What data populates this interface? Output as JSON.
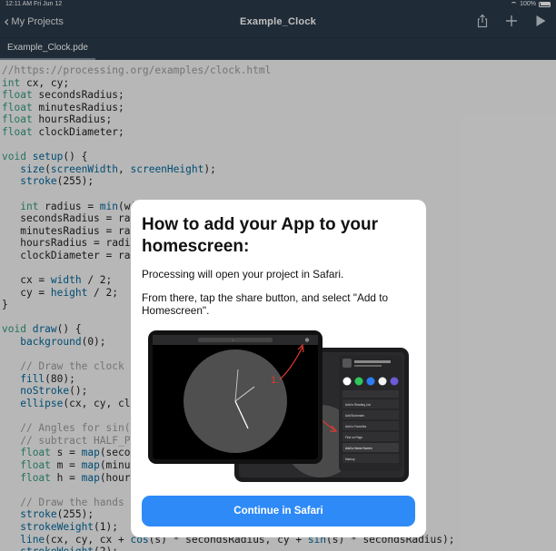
{
  "status_bar": {
    "time": "12:11 AM   Fri Jun 12",
    "battery": "100%",
    "battery_level": 1.0
  },
  "nav": {
    "back_label": "My Projects",
    "title": "Example_Clock",
    "icons": [
      "share-icon",
      "plus-icon",
      "play-icon"
    ]
  },
  "tab": {
    "label": "Example_Clock.pde"
  },
  "code_lines": [
    [
      [
        "cm",
        "//https://processing.org/examples/clock.html"
      ]
    ],
    [
      [
        "kw",
        "int"
      ],
      [
        "",
        " cx, cy;"
      ]
    ],
    [
      [
        "kw",
        "float"
      ],
      [
        "",
        " secondsRadius;"
      ]
    ],
    [
      [
        "kw",
        "float"
      ],
      [
        "",
        " minutesRadius;"
      ]
    ],
    [
      [
        "kw",
        "float"
      ],
      [
        "",
        " hoursRadius;"
      ]
    ],
    [
      [
        "kw",
        "float"
      ],
      [
        "",
        " clockDiameter;"
      ]
    ],
    [],
    [
      [
        "kw",
        "void"
      ],
      [
        "",
        " "
      ],
      [
        "fn",
        "setup"
      ],
      [
        "",
        "() {"
      ]
    ],
    [
      [
        "",
        "   "
      ],
      [
        "fn",
        "size"
      ],
      [
        "",
        "("
      ],
      [
        "fn",
        "screenWidth"
      ],
      [
        "",
        ", "
      ],
      [
        "fn",
        "screenHeight"
      ],
      [
        "",
        ");"
      ]
    ],
    [
      [
        "",
        "   "
      ],
      [
        "fn",
        "stroke"
      ],
      [
        "",
        "(255);"
      ]
    ],
    [],
    [
      [
        "",
        "   "
      ],
      [
        "kw",
        "int"
      ],
      [
        "",
        " radius = "
      ],
      [
        "fn",
        "min"
      ],
      [
        "",
        "(wi"
      ]
    ],
    [
      [
        "",
        "   secondsRadius = rad"
      ]
    ],
    [
      [
        "",
        "   minutesRadius = rad"
      ]
    ],
    [
      [
        "",
        "   hoursRadius = radiu"
      ]
    ],
    [
      [
        "",
        "   clockDiameter = rad"
      ]
    ],
    [],
    [
      [
        "",
        "   cx = "
      ],
      [
        "fn",
        "width"
      ],
      [
        "",
        " / 2;"
      ]
    ],
    [
      [
        "",
        "   cy = "
      ],
      [
        "fn",
        "height"
      ],
      [
        "",
        " / 2;"
      ]
    ],
    [
      [
        "",
        "}"
      ]
    ],
    [],
    [
      [
        "kw",
        "void"
      ],
      [
        "",
        " "
      ],
      [
        "fn",
        "draw"
      ],
      [
        "",
        "() {"
      ]
    ],
    [
      [
        "",
        "   "
      ],
      [
        "fn",
        "background"
      ],
      [
        "",
        "(0);"
      ]
    ],
    [],
    [
      [
        "",
        "   "
      ],
      [
        "cm",
        "// Draw the clock b"
      ]
    ],
    [
      [
        "",
        "   "
      ],
      [
        "fn",
        "fill"
      ],
      [
        "",
        "(80);"
      ]
    ],
    [
      [
        "",
        "   "
      ],
      [
        "fn",
        "noStroke"
      ],
      [
        "",
        "();"
      ]
    ],
    [
      [
        "",
        "   "
      ],
      [
        "fn",
        "ellipse"
      ],
      [
        "",
        "(cx, cy, clo"
      ]
    ],
    [],
    [
      [
        "",
        "   "
      ],
      [
        "cm",
        "// Angles for sin()"
      ]
    ],
    [
      [
        "",
        "   "
      ],
      [
        "cm",
        "// subtract HALF_PI"
      ]
    ],
    [
      [
        "",
        "   "
      ],
      [
        "kw",
        "float"
      ],
      [
        "",
        " s = "
      ],
      [
        "fn",
        "map"
      ],
      [
        "",
        "(secon"
      ]
    ],
    [
      [
        "",
        "   "
      ],
      [
        "kw",
        "float"
      ],
      [
        "",
        " m = "
      ],
      [
        "fn",
        "map"
      ],
      [
        "",
        "(minut                                    HALF_PI;"
      ]
    ],
    [
      [
        "",
        "   "
      ],
      [
        "kw",
        "float"
      ],
      [
        "",
        " h = "
      ],
      [
        "fn",
        "map"
      ],
      [
        "",
        "(hour(                                     HALF_PI;"
      ]
    ],
    [],
    [
      [
        "",
        "   "
      ],
      [
        "cm",
        "// Draw the hands o"
      ]
    ],
    [
      [
        "",
        "   "
      ],
      [
        "fn",
        "stroke"
      ],
      [
        "",
        "(255);"
      ]
    ],
    [
      [
        "",
        "   "
      ],
      [
        "fn",
        "strokeWeight"
      ],
      [
        "",
        "(1);"
      ]
    ],
    [
      [
        "",
        "   "
      ],
      [
        "fn",
        "line"
      ],
      [
        "",
        "(cx, cy, cx + "
      ],
      [
        "fn",
        "cos"
      ],
      [
        "",
        "(s) * secondsRadius, cy + "
      ],
      [
        "fn",
        "sin"
      ],
      [
        "",
        "(s) * secondsRadius);"
      ]
    ],
    [
      [
        "",
        "   "
      ],
      [
        "fn",
        "strokeWeight"
      ],
      [
        "",
        "(2);"
      ]
    ]
  ],
  "modal": {
    "title": "How to add your App to your homescreen:",
    "line1": "Processing will open your project in Safari.",
    "line2": "From there, tap the share button, and select \"Add to Homescreen\".",
    "step1": "1.",
    "step2": "2.",
    "share_menu_items": [
      "Add to Reading List",
      "Add Bookmark",
      "Add to Favorites",
      "Find on Page",
      "Add to Home Screen",
      "Markup"
    ],
    "button_label": "Continue in Safari"
  },
  "colors": {
    "bar": "#2a3a4a",
    "accent": "#2e8af7",
    "keyword": "#33997e",
    "function": "#006699",
    "comment": "#9a9a9a"
  }
}
